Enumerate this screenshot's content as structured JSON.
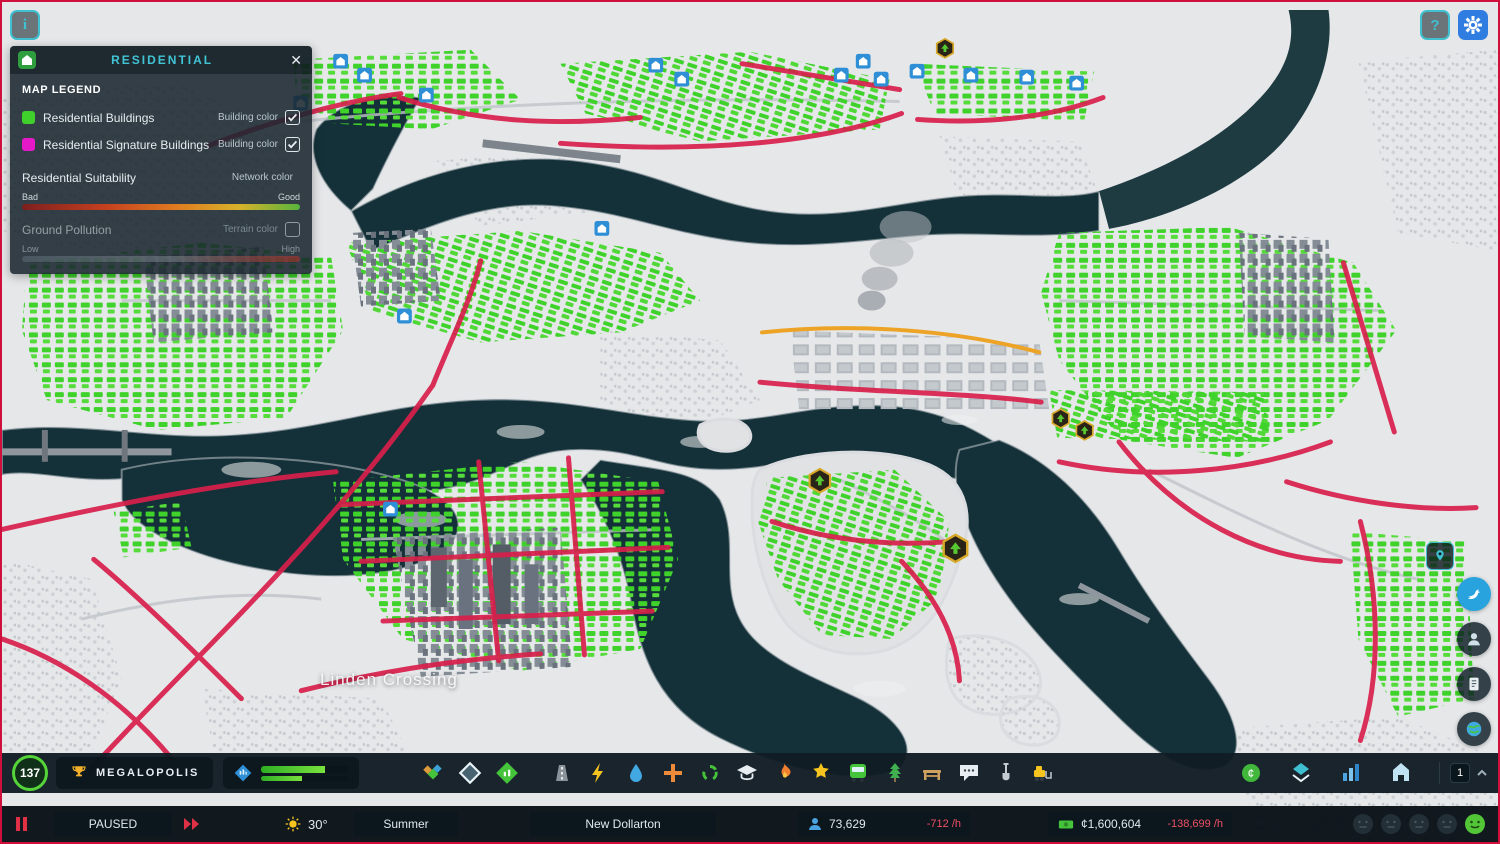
{
  "ui": {
    "info_button": "i",
    "help_button": "?",
    "close_button": "✕"
  },
  "legend": {
    "title": "RESIDENTIAL",
    "heading": "MAP LEGEND",
    "rows": [
      {
        "label": "Residential Buildings",
        "color_type": "Building color"
      },
      {
        "label": "Residential Signature Buildings",
        "color_type": "Building color"
      }
    ],
    "suitability": {
      "label": "Residential Suitability",
      "color_type": "Network color",
      "min": "Bad",
      "max": "Good"
    },
    "pollution": {
      "label": "Ground Pollution",
      "color_type": "Terrain color",
      "min": "Low",
      "max": "High"
    }
  },
  "map": {
    "area_label": "Linden Crossing"
  },
  "toolbar": {
    "level": "137",
    "milestone": "MEGALOPOLIS",
    "notification_count": "1",
    "tools": [
      "zoning",
      "areas",
      "signature-buildings",
      "roads",
      "electricity",
      "water-sewage",
      "healthcare",
      "garbage",
      "education",
      "fire-rescue",
      "police",
      "transportation",
      "parks",
      "recreation",
      "communications",
      "landscaping",
      "bulldozer"
    ],
    "right_tools": [
      "economy",
      "info-views",
      "statistics",
      "progression"
    ]
  },
  "statusbar": {
    "pause_label": "PAUSED",
    "temperature": "30°",
    "season": "Summer",
    "city_name": "New Dollarton",
    "population": "73,629",
    "population_rate": "-712 /h",
    "budget": "¢1,600,604",
    "budget_rate": "-138,699 /h"
  },
  "colors": {
    "residential": "#3fd02c",
    "signature": "#e619c9",
    "accent_teal": "#3fc1d1",
    "negative": "#ef5064",
    "water": "#143139",
    "road_red": "#d81f4b"
  }
}
